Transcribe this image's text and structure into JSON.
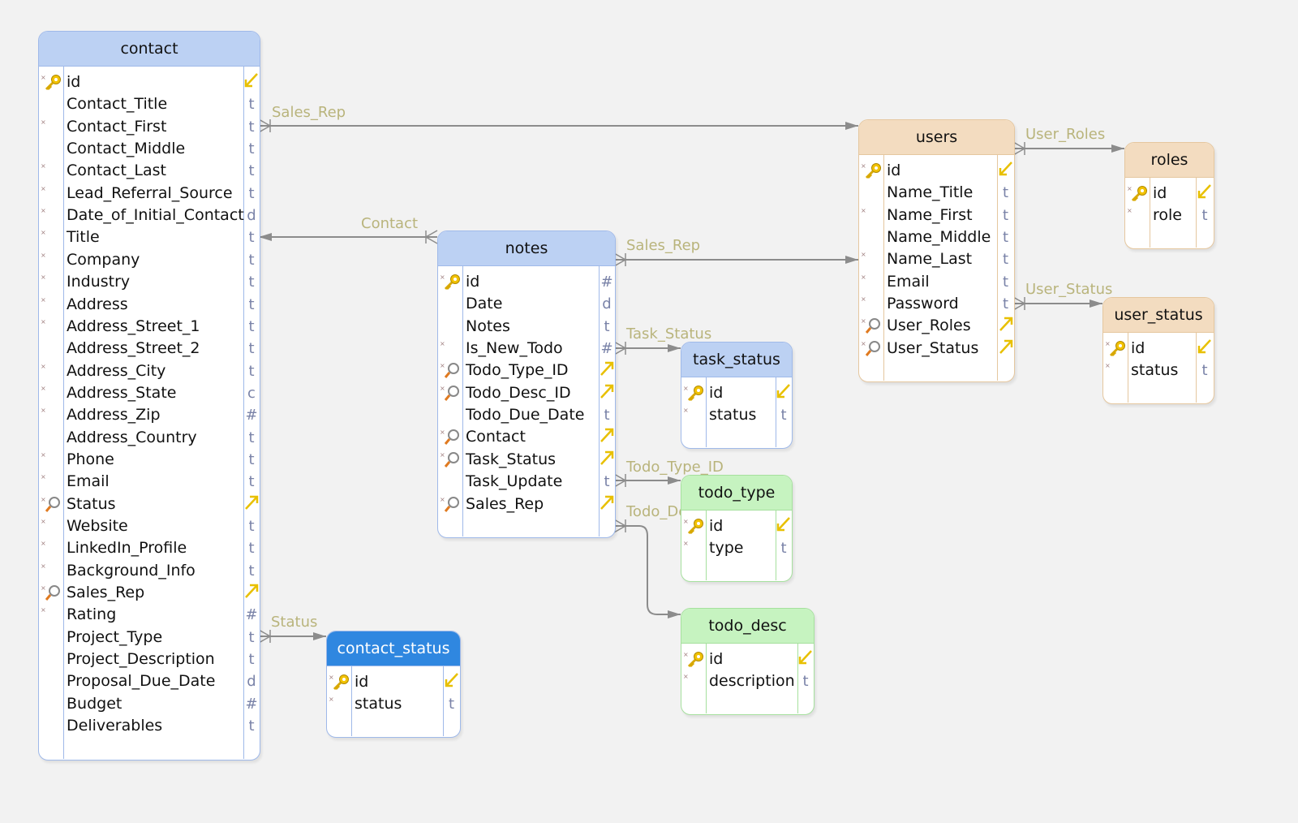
{
  "colors": {
    "blue_header": "#bcd1f3",
    "blue_border": "#9fb9e9",
    "tan_header": "#f3dcc0",
    "tan_border": "#e5c79f",
    "green_header": "#c6f3c0",
    "green_border": "#a6e09e",
    "selected_header": "#2f87e0",
    "line": "#8c8c8c",
    "relation_label": "#b9b47c",
    "type_glyph": "#7a83a8",
    "key_icon": "#e8b800"
  },
  "tables": [
    {
      "name": "contact",
      "theme": "blue",
      "columns": [
        {
          "name": "id",
          "type": "pk",
          "key": true,
          "nn": true
        },
        {
          "name": "Contact_Title",
          "type": "t"
        },
        {
          "name": "Contact_First",
          "type": "t",
          "nn": true
        },
        {
          "name": "Contact_Middle",
          "type": "t"
        },
        {
          "name": "Contact_Last",
          "type": "t",
          "nn": true
        },
        {
          "name": "Lead_Referral_Source",
          "type": "t",
          "nn": true
        },
        {
          "name": "Date_of_Initial_Contact",
          "type": "d",
          "nn": true
        },
        {
          "name": "Title",
          "type": "t",
          "nn": true
        },
        {
          "name": "Company",
          "type": "t",
          "nn": true
        },
        {
          "name": "Industry",
          "type": "t",
          "nn": true
        },
        {
          "name": "Address",
          "type": "t",
          "nn": true
        },
        {
          "name": "Address_Street_1",
          "type": "t",
          "nn": true
        },
        {
          "name": "Address_Street_2",
          "type": "t"
        },
        {
          "name": "Address_City",
          "type": "t",
          "nn": true
        },
        {
          "name": "Address_State",
          "type": "c",
          "nn": true
        },
        {
          "name": "Address_Zip",
          "type": "#",
          "nn": true
        },
        {
          "name": "Address_Country",
          "type": "t"
        },
        {
          "name": "Phone",
          "type": "t",
          "nn": true
        },
        {
          "name": "Email",
          "type": "t",
          "nn": true
        },
        {
          "name": "Status",
          "type": "fk",
          "idx": true,
          "nn": true
        },
        {
          "name": "Website",
          "type": "t",
          "nn": true
        },
        {
          "name": "LinkedIn_Profile",
          "type": "t",
          "nn": true
        },
        {
          "name": "Background_Info",
          "type": "t",
          "nn": true
        },
        {
          "name": "Sales_Rep",
          "type": "fk",
          "idx": true,
          "nn": true
        },
        {
          "name": "Rating",
          "type": "#",
          "nn": true
        },
        {
          "name": "Project_Type",
          "type": "t"
        },
        {
          "name": "Project_Description",
          "type": "t"
        },
        {
          "name": "Proposal_Due_Date",
          "type": "d"
        },
        {
          "name": "Budget",
          "type": "#"
        },
        {
          "name": "Deliverables",
          "type": "t"
        }
      ]
    },
    {
      "name": "notes",
      "theme": "blue",
      "columns": [
        {
          "name": "id",
          "type": "#",
          "key": true,
          "nn": true
        },
        {
          "name": "Date",
          "type": "d"
        },
        {
          "name": "Notes",
          "type": "t"
        },
        {
          "name": "Is_New_Todo",
          "type": "#",
          "nn": true
        },
        {
          "name": "Todo_Type_ID",
          "type": "fk",
          "idx": true,
          "nn": true
        },
        {
          "name": "Todo_Desc_ID",
          "type": "fk",
          "idx": true,
          "nn": true
        },
        {
          "name": "Todo_Due_Date",
          "type": "t"
        },
        {
          "name": "Contact",
          "type": "fk",
          "idx": true,
          "nn": true
        },
        {
          "name": "Task_Status",
          "type": "fk",
          "idx": true,
          "nn": true
        },
        {
          "name": "Task_Update",
          "type": "t"
        },
        {
          "name": "Sales_Rep",
          "type": "fk",
          "idx": true,
          "nn": true
        }
      ]
    },
    {
      "name": "users",
      "theme": "tan",
      "columns": [
        {
          "name": "id",
          "type": "pk",
          "key": true,
          "nn": true
        },
        {
          "name": "Name_Title",
          "type": "t"
        },
        {
          "name": "Name_First",
          "type": "t",
          "nn": true
        },
        {
          "name": "Name_Middle",
          "type": "t"
        },
        {
          "name": "Name_Last",
          "type": "t",
          "nn": true
        },
        {
          "name": "Email",
          "type": "t",
          "nn": true
        },
        {
          "name": "Password",
          "type": "t",
          "nn": true
        },
        {
          "name": "User_Roles",
          "type": "fk",
          "idx": true,
          "nn": true
        },
        {
          "name": "User_Status",
          "type": "fk",
          "idx": true,
          "nn": true
        }
      ]
    },
    {
      "name": "roles",
      "theme": "tan",
      "columns": [
        {
          "name": "id",
          "type": "pk",
          "key": true,
          "nn": true
        },
        {
          "name": "role",
          "type": "t",
          "nn": true
        }
      ]
    },
    {
      "name": "user_status",
      "theme": "tan",
      "columns": [
        {
          "name": "id",
          "type": "pk",
          "key": true,
          "nn": true
        },
        {
          "name": "status",
          "type": "t",
          "nn": true
        }
      ]
    },
    {
      "name": "task_status",
      "theme": "blue",
      "columns": [
        {
          "name": "id",
          "type": "pk",
          "key": true,
          "nn": true
        },
        {
          "name": "status",
          "type": "t",
          "nn": true
        }
      ]
    },
    {
      "name": "todo_type",
      "theme": "green",
      "columns": [
        {
          "name": "id",
          "type": "pk",
          "key": true,
          "nn": true
        },
        {
          "name": "type",
          "type": "t",
          "nn": true
        }
      ]
    },
    {
      "name": "todo_desc",
      "theme": "green",
      "columns": [
        {
          "name": "id",
          "type": "pk",
          "key": true,
          "nn": true
        },
        {
          "name": "description",
          "type": "t",
          "nn": true
        }
      ]
    },
    {
      "name": "contact_status",
      "theme": "selected",
      "columns": [
        {
          "name": "id",
          "type": "pk",
          "key": true,
          "nn": true
        },
        {
          "name": "status",
          "type": "t",
          "nn": true
        }
      ]
    }
  ],
  "relations": [
    {
      "label": "Sales_Rep",
      "from": "contact",
      "to": "users"
    },
    {
      "label": "Contact",
      "from": "notes",
      "to": "contact"
    },
    {
      "label": "Sales_Rep",
      "from": "notes",
      "to": "users"
    },
    {
      "label": "Task_Status",
      "from": "notes",
      "to": "task_status"
    },
    {
      "label": "Todo_Type_ID",
      "from": "notes",
      "to": "todo_type"
    },
    {
      "label": "Todo_Desc_ID",
      "from": "notes",
      "to": "todo_desc"
    },
    {
      "label": "User_Roles",
      "from": "users",
      "to": "roles"
    },
    {
      "label": "User_Status",
      "from": "users",
      "to": "user_status"
    },
    {
      "label": "Status",
      "from": "contact",
      "to": "contact_status"
    }
  ]
}
